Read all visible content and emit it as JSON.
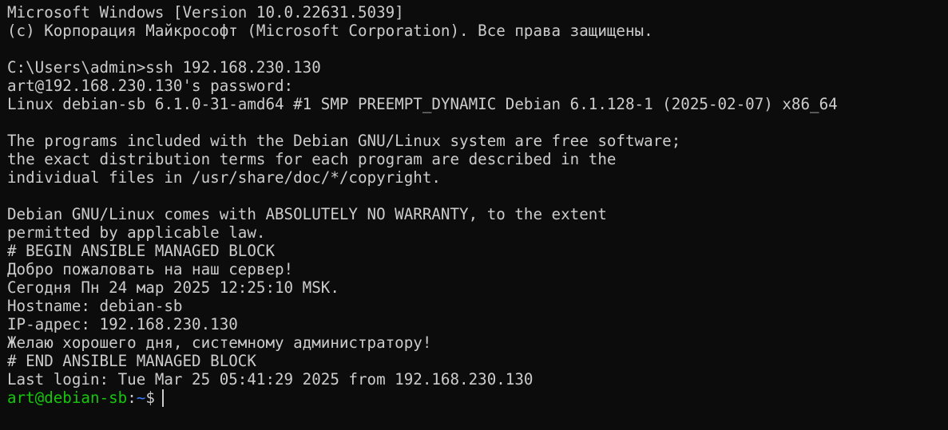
{
  "colors": {
    "background": "#0c0c0c",
    "foreground": "#cccccc",
    "prompt_user": "#16c60c",
    "prompt_path": "#3b78ff"
  },
  "terminal": {
    "lines": [
      "Microsoft Windows [Version 10.0.22631.5039]",
      "(c) Корпорация Майкрософт (Microsoft Corporation). Все права защищены.",
      "",
      "C:\\Users\\admin>ssh 192.168.230.130",
      "art@192.168.230.130's password:",
      "Linux debian-sb 6.1.0-31-amd64 #1 SMP PREEMPT_DYNAMIC Debian 6.1.128-1 (2025-02-07) x86_64",
      "",
      "The programs included with the Debian GNU/Linux system are free software;",
      "the exact distribution terms for each program are described in the",
      "individual files in /usr/share/doc/*/copyright.",
      "",
      "Debian GNU/Linux comes with ABSOLUTELY NO WARRANTY, to the extent",
      "permitted by applicable law.",
      "# BEGIN ANSIBLE MANAGED BLOCK",
      "Добро пожаловать на наш сервер!",
      "Сегодня Пн 24 мар 2025 12:25:10 MSK.",
      "Hostname: debian-sb",
      "IP-адрес: 192.168.230.130",
      "Желаю хорошего дня, системному администратору!",
      "# END ANSIBLE MANAGED BLOCK",
      "Last login: Tue Mar 25 05:41:29 2025 from 192.168.230.130"
    ],
    "prompt": {
      "user_host": "art@debian-sb",
      "separator": ":",
      "path": "~",
      "symbol": "$"
    }
  }
}
